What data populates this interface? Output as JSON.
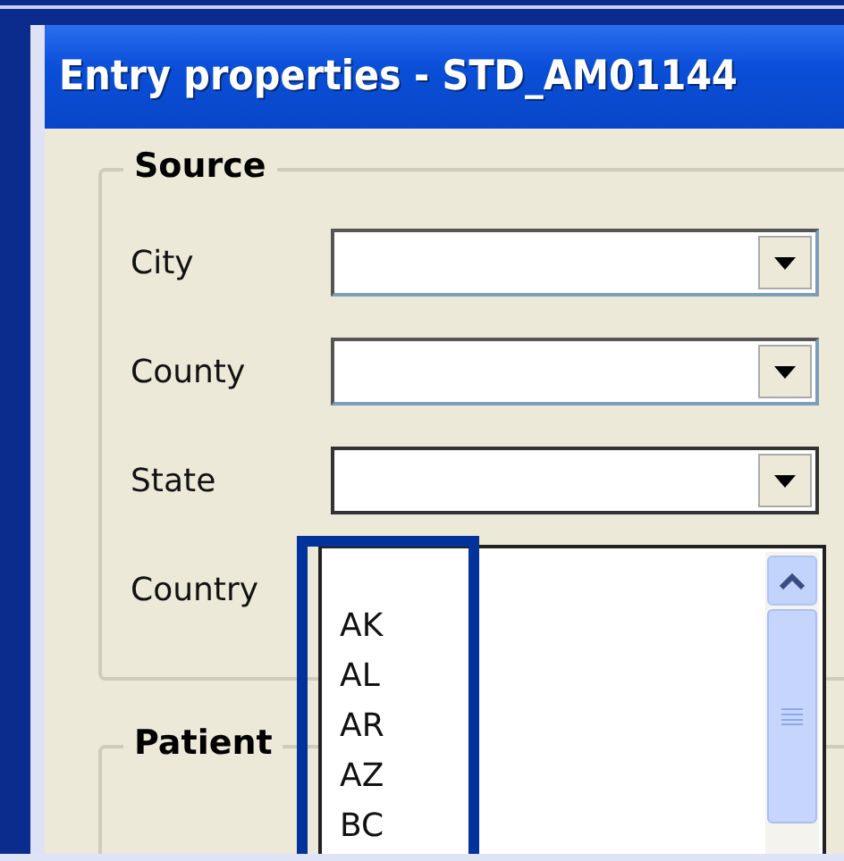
{
  "window": {
    "title": "Entry properties - STD_AM01144"
  },
  "groups": [
    {
      "title": "Source",
      "fields": [
        {
          "label": "City",
          "expanded": false
        },
        {
          "label": "County",
          "expanded": false
        },
        {
          "label": "State",
          "expanded": true
        },
        {
          "label": "Country",
          "expanded": false
        }
      ]
    },
    {
      "title": "Patient"
    }
  ],
  "dropdown": {
    "items": [
      "AK",
      "AL",
      "AR",
      "AZ",
      "BC"
    ]
  }
}
